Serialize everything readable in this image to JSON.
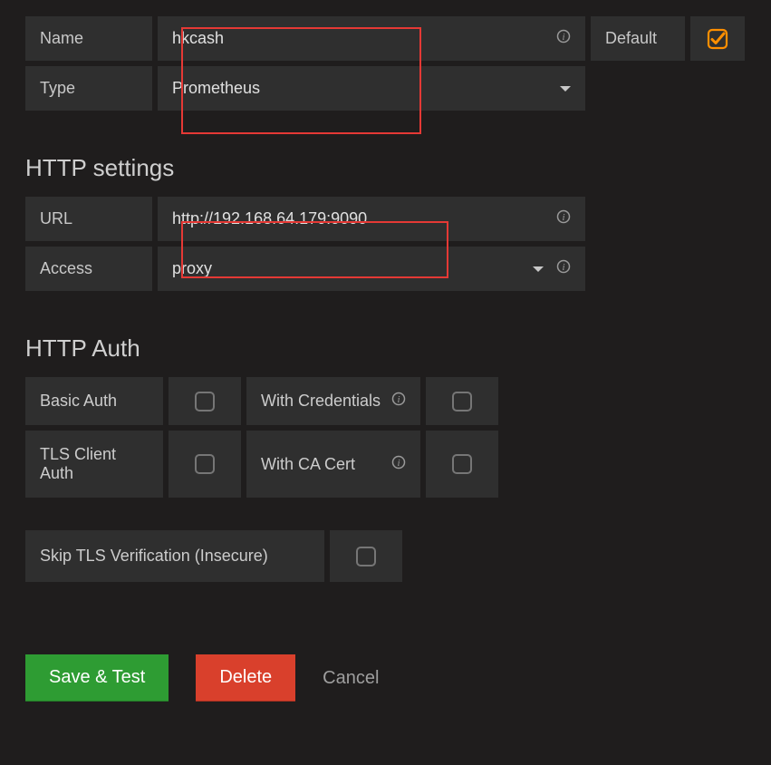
{
  "name_row": {
    "label": "Name",
    "value": "hkcash"
  },
  "type_row": {
    "label": "Type",
    "value": "Prometheus"
  },
  "default_label": "Default",
  "http_settings_heading": "HTTP settings",
  "url_row": {
    "label": "URL",
    "value": "http://192.168.64.179:9090"
  },
  "access_row": {
    "label": "Access",
    "value": "proxy"
  },
  "http_auth_heading": "HTTP Auth",
  "auth": {
    "basic": "Basic Auth",
    "with_credentials": "With Credentials",
    "tls_client": "TLS Client Auth",
    "with_ca": "With CA Cert"
  },
  "skip_tls": "Skip TLS Verification (Insecure)",
  "buttons": {
    "save_test": "Save & Test",
    "delete": "Delete",
    "cancel": "Cancel"
  }
}
